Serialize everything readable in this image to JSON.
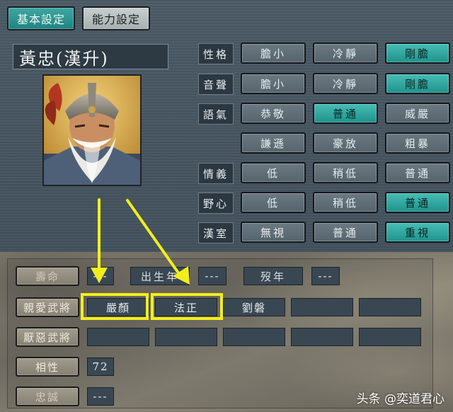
{
  "tabs": [
    {
      "label": "基本設定",
      "active": true
    },
    {
      "label": "能力設定",
      "active": false
    }
  ],
  "officer": {
    "name": "黃忠(漢升)"
  },
  "attributes": [
    {
      "label": "性格",
      "options": [
        "膽小",
        "冷靜",
        "剛膽"
      ],
      "selected": 2
    },
    {
      "label": "音聲",
      "options": [
        "膽小",
        "冷靜",
        "剛膽"
      ],
      "selected": 2
    },
    {
      "label": "語氣",
      "options": [
        "恭敬",
        "普通",
        "威嚴"
      ],
      "selected": 1
    },
    {
      "label": "",
      "options": [
        "謙遜",
        "豪放",
        "粗暴"
      ],
      "selected": -1
    },
    {
      "label": "情義",
      "options": [
        "低",
        "稍低",
        "普通"
      ],
      "selected": -1
    },
    {
      "label": "野心",
      "options": [
        "低",
        "稍低",
        "普通"
      ],
      "selected": 2
    },
    {
      "label": "漢室",
      "options": [
        "無視",
        "普通",
        "重視"
      ],
      "selected": 2
    }
  ],
  "lifespan": {
    "label": "壽命",
    "value": "---",
    "birth_label": "出生年",
    "birth_value": "---",
    "death_label": "歿年",
    "death_value": "---"
  },
  "favored": {
    "label": "親愛武將",
    "cells": [
      "嚴顏",
      "法正",
      "劉磐",
      "",
      ""
    ]
  },
  "disliked": {
    "label": "厭惡武將",
    "cells": [
      "",
      "",
      "",
      "",
      ""
    ]
  },
  "compatibility": {
    "label": "相性",
    "value": "72"
  },
  "loyalty": {
    "label": "忠誠",
    "value": "---"
  },
  "watermark": "头条 @奕道君心",
  "colors": {
    "annotation": "#f2ee1c",
    "selected": "#2aa8a0"
  }
}
